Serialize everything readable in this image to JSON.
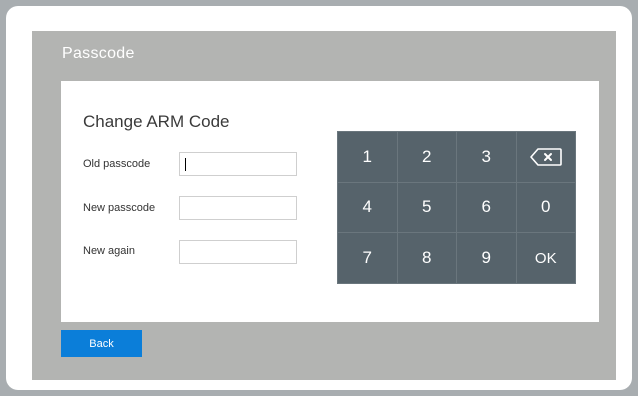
{
  "header": {
    "title": "Passcode"
  },
  "form": {
    "title": "Change ARM Code",
    "fields": [
      {
        "label": "Old passcode",
        "value": ""
      },
      {
        "label": "New passcode",
        "value": ""
      },
      {
        "label": "New again",
        "value": ""
      }
    ]
  },
  "keypad": {
    "keys": [
      "1",
      "2",
      "3",
      "backspace",
      "4",
      "5",
      "6",
      "0",
      "7",
      "8",
      "9",
      "OK"
    ]
  },
  "footer": {
    "back_label": "Back"
  },
  "colors": {
    "keypad_bg": "#56636b",
    "accent": "#0b7ed9",
    "screen_bg": "#b3b4b2"
  }
}
